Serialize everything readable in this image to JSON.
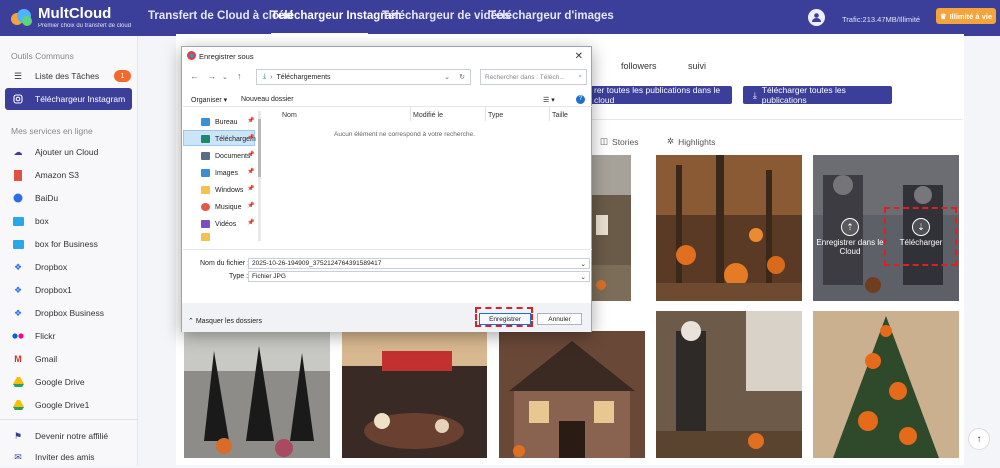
{
  "nav": {
    "brand": "MultCloud",
    "tagline": "Premier choix du transfert de cloud",
    "tabs": [
      "Transfert de Cloud à cloud",
      "Téléchargeur Instagram",
      "Téléchargeur de vidéos",
      "Téléchargeur d'images"
    ],
    "active_tab": 1,
    "traffic": "Trafic:213.47MB/Illimité",
    "unlimited_btn": "Illimité à vie"
  },
  "sidebar": {
    "section1": "Outils Communs",
    "tasks": "Liste des Tâches",
    "tasks_badge": "1",
    "instagram": "Téléchargeur Instagram",
    "section2": "Mes services en ligne",
    "services": [
      "Ajouter un Cloud",
      "Amazon S3",
      "BaiDu",
      "box",
      "box for Business",
      "Dropbox",
      "Dropbox1",
      "Dropbox Business",
      "Flickr",
      "Gmail",
      "Google Drive",
      "Google Drive1"
    ],
    "affiliate": "Devenir notre affilié",
    "invite": "Inviter des amis"
  },
  "profile": {
    "followers_label": "followers",
    "following_label": "suivi",
    "btn_cloud": "rer toutes les publications dans le cloud",
    "btn_download": "Télécharger toutes les publications",
    "tab_stories": "Stories",
    "tab_highlights": "Highlights"
  },
  "overlay": {
    "save_cloud": "Enregistrer dans le Cloud",
    "download": "Télécharger"
  },
  "dialog": {
    "title": "Enregistrer sous",
    "address": "Téléchargements",
    "search_placeholder": "Rechercher dans : Téléch...",
    "organize": "Organiser",
    "new_folder": "Nouveau dossier",
    "tree": [
      "Bureau",
      "Téléchargem",
      "Documents",
      "Images",
      "Windows",
      "Musique",
      "Vidéos"
    ],
    "columns": [
      "Nom",
      "Modifié le",
      "Type",
      "Taille"
    ],
    "empty": "Aucun élément ne correspond à votre recherche.",
    "filename_label": "Nom du fichier :",
    "filename": "2025-10-26-194909_3752124764391589417",
    "type_label": "Type :",
    "type_value": "Fichier JPG",
    "hide_folders": "Masquer les dossiers",
    "save": "Enregistrer",
    "cancel": "Annuler"
  },
  "colors": {
    "brand": "#3b3f9a",
    "accent": "#f5a33b",
    "highlight": "#e02020"
  }
}
